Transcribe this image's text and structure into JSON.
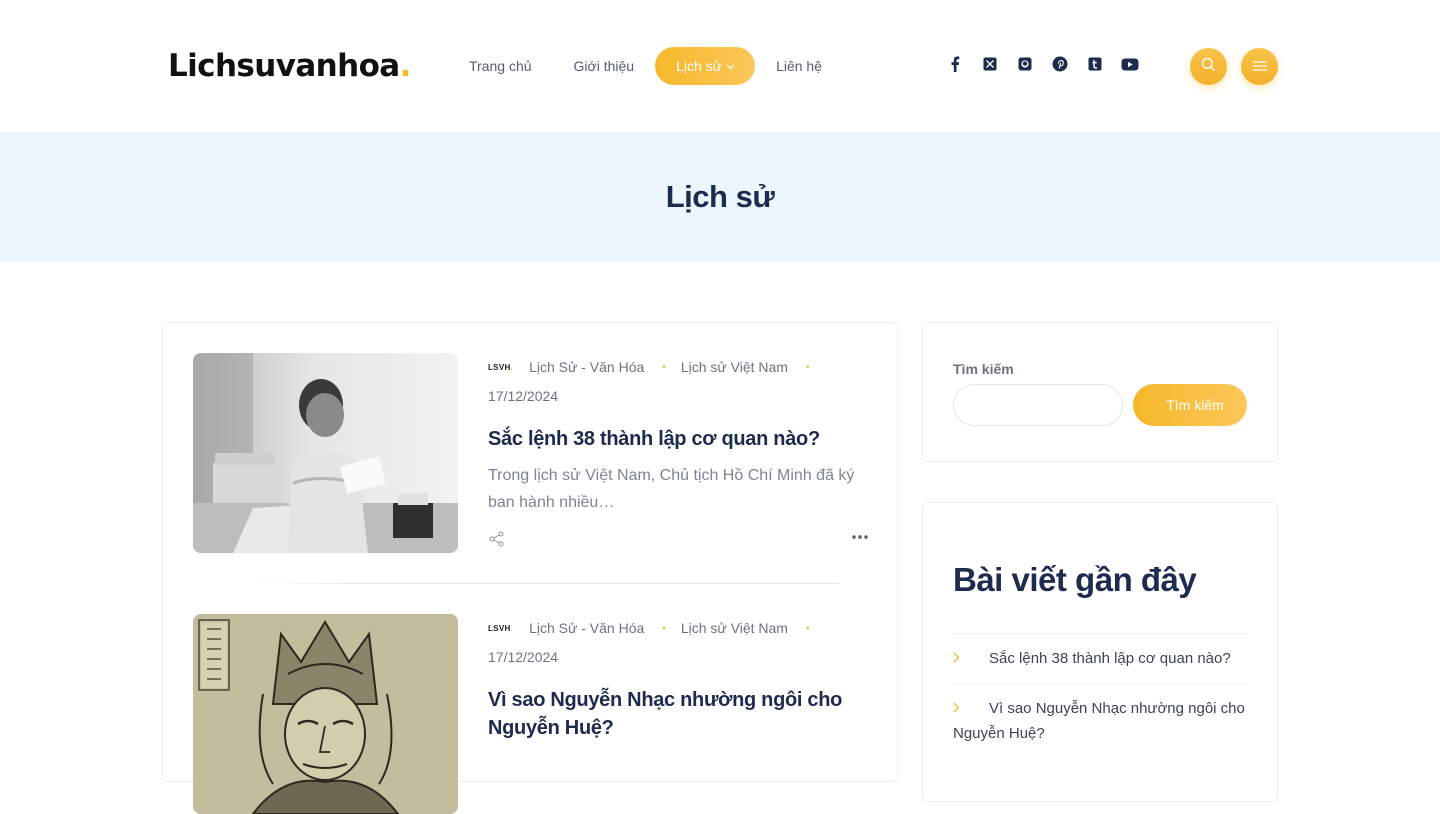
{
  "header": {
    "logo_text": "Lichsuvanhoa",
    "logo_dot": ".",
    "nav": [
      {
        "label": "Trang chủ"
      },
      {
        "label": "Giới thiệu"
      },
      {
        "label": "Lịch sử",
        "active": true
      },
      {
        "label": "Liên hệ"
      }
    ],
    "socials": [
      "facebook-icon",
      "x-twitter-icon",
      "github-icon",
      "pinterest-icon",
      "tumblr-icon",
      "youtube-icon"
    ],
    "search_button_icon": "search-icon",
    "menu_button_icon": "hamburger-menu-icon"
  },
  "banner": {
    "title": "Lịch sử"
  },
  "posts": [
    {
      "badge": "LSVH",
      "badge_dot": ".",
      "categories": [
        "Lịch Sử - Văn Hóa",
        "Lịch sử Việt Nam"
      ],
      "date": "17/12/2024",
      "title": "Sắc lệnh 38 thành lập cơ quan nào?",
      "excerpt": "Trong lịch sử Việt Nam, Chủ tịch Hồ Chí Minh đã ký ban hành nhiều…"
    },
    {
      "badge": "LSVH",
      "badge_dot": ".",
      "categories": [
        "Lịch Sử - Văn Hóa",
        "Lịch sử Việt Nam"
      ],
      "date": "17/12/2024",
      "title": "Vì sao Nguyễn Nhạc nhường ngôi cho Nguyễn Huệ?"
    }
  ],
  "sidebar": {
    "search": {
      "label": "Tìm kiếm",
      "placeholder": "",
      "button_label": "Tìm kiếm"
    },
    "recent": {
      "title": "Bài viết gần đây",
      "items": [
        {
          "label": "Sắc lệnh 38 thành lập cơ quan nào?"
        },
        {
          "label": "Vì sao Nguyễn Nhạc nhường ngôi cho Nguyễn Huệ?"
        }
      ]
    }
  },
  "colors": {
    "accent": "#f5b82b",
    "heading": "#1d2b4f",
    "banner_bg": "#edf5fd"
  }
}
